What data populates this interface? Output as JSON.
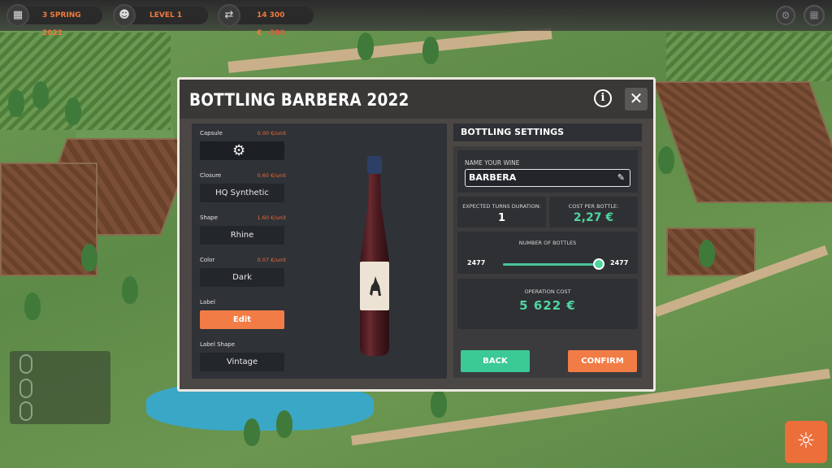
{
  "hud": {
    "date": "3 SPRING 2022",
    "level": "LEVEL 1",
    "money": "14 300 €",
    "money_delta": "-300"
  },
  "dialog": {
    "title": "BOTTLING BARBERA 2022",
    "info_label": "i",
    "close_label": "✕",
    "options": {
      "capsule": {
        "label": "Capsule",
        "price": "0.00 €/unit"
      },
      "closure": {
        "label": "Closure",
        "price": "0.60 €/unit",
        "value": "HQ Synthetic"
      },
      "shape": {
        "label": "Shape",
        "price": "1.60 €/unit",
        "value": "Rhine"
      },
      "color": {
        "label": "Color",
        "price": "0.07 €/unit",
        "value": "Dark"
      },
      "label": {
        "label": "Label",
        "value": "Edit"
      },
      "label_shape": {
        "label": "Label Shape",
        "value": "Vintage"
      }
    },
    "settings": {
      "header": "BOTTLING SETTINGS",
      "name_label": "NAME YOUR WINE",
      "wine_name": "BARBERA",
      "turns_label": "EXPECTED TURNS DURATION:",
      "turns_value": "1",
      "cost_bottle_label": "COST PER BOTTLE:",
      "cost_bottle_value": "2,27 €",
      "bottles_label": "NUMBER OF BOTTLES",
      "bottles_min": "2477",
      "bottles_max": "2477",
      "bottles_fraction": 1.0,
      "op_cost_label": "OPERATION COST",
      "op_cost_value": "5 622 €"
    },
    "back_label": "BACK",
    "confirm_label": "CONFIRM"
  },
  "colors": {
    "accent_orange": "#f27c45",
    "accent_green": "#3bc996",
    "panel_dark": "#2f3237"
  },
  "icons": [
    "calendar-icon",
    "head-icon",
    "money-icon",
    "settings-icon",
    "menu-icon",
    "gear-icon",
    "pencil-icon",
    "sun-icon"
  ]
}
